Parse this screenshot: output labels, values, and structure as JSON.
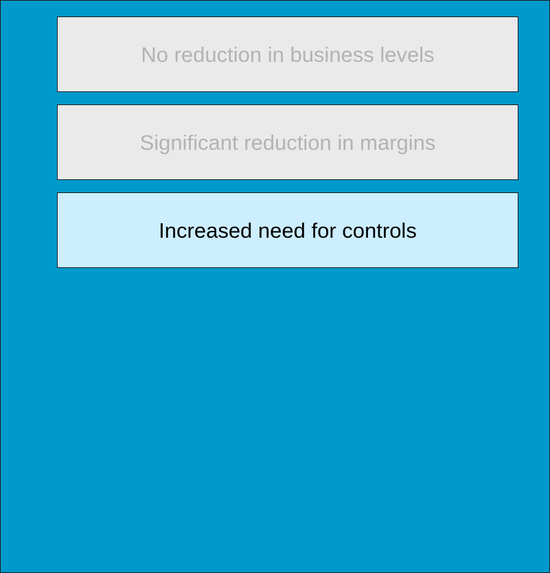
{
  "items": [
    {
      "label": "No reduction in business levels",
      "state": "dimmed"
    },
    {
      "label": "Significant reduction in margins",
      "state": "dimmed"
    },
    {
      "label": "Increased need for controls",
      "state": "highlighted"
    }
  ],
  "colors": {
    "background": "#0099cc",
    "dimmed_fill": "#eaeaea",
    "dimmed_text": "#b3b3b3",
    "highlighted_fill": "#cceeff",
    "highlighted_text": "#000000"
  }
}
